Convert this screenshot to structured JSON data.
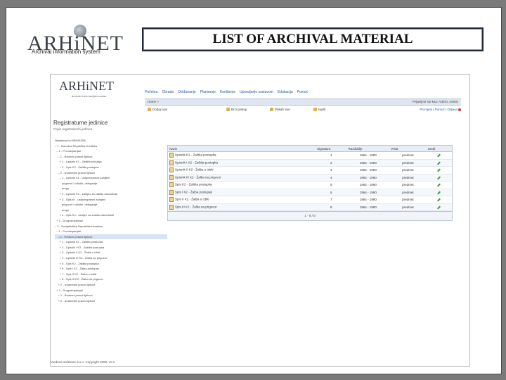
{
  "slide": {
    "logo_text": "ARHiNET",
    "logo_subtitle": "Archival information system",
    "title": "LIST OF ARCHIVAL MATERIAL"
  },
  "app": {
    "logo_text": "ARHiNET",
    "logo_subtitle": "arhivski informacijski sustav",
    "menu": [
      "Početna",
      "Obrada",
      "Održavanje",
      "Planiranje",
      "Korištenje",
      "Upravljanje sustavom",
      "Edukacija",
      "Pomoć"
    ],
    "breadcrumb": "Home »",
    "user_info": "Prijavljeni ste kao: Admin, Admin",
    "toolbar": [
      "Dodaj novi",
      "Brzi pristup",
      "Prikaži sve",
      "Ispiši"
    ],
    "right_tools": "Promjeni | Pomoć | Odjava",
    "panel_title": "Registraturne jedinice",
    "panel_subtitle": "Popis registraturnih jedinica",
    "tree": [
      "Nastavna Kn:NR/NS/SR/...",
      "– 1 - Narodna Republika Hrvatska",
      "  – 1 - Prvostupanjski",
      "    – 1 - Redovni pravni lijekovi",
      "      + 1 - Upisnik K1 - Zaštita položaja",
      "      + 2 - Spis K2 - Zaštita postupka",
      "    – 2 - Izvanredni pravni lijekovi",
      "      – 1 - Upisnik K1 - ustavnopravni zahtjevi",
      "         prigovori i odluke, delegacije",
      "         drugo",
      "      + 2 - Upisnik Kn - zahtjev za zaštitu zakonitosti",
      "      + 3 - Spis Kr - ustavnopravni zahtjevi",
      "         prigovori i odluke, delegacije",
      "         drugo",
      "      + 4 - Spis Kn - zahtjev za zaštitu zakonitosti",
      "  + 2 - Drugostupanjski",
      "– 2 - Socijalistička Republika Hrvatska",
      "  – 1 - Prvostupanjski",
      "    – 1 - Redovni pravni lijekovi",
      "      + 1 - Upisnik K1 - Zaštita postupka",
      "      + 2 - Upisnik I K2 - Zaštita postupka",
      "      + 3 - Upisnik II K2 - Žalba u izbiti",
      "      + 4 - Upisnik III K2 - Žalba na prigovor",
      "      + 5 - Spis K2 - Zaštita postupka",
      "      + 6 - Spis I K2 - Žalba postupak",
      "      + 7 - Spis II K2 - Žalba u izbiti",
      "      + 8 - Spis III K2 - Žalba na prigovor",
      "    + 2 - Izvanredni pravni lijekovi",
      "  + 2 - Drugostupanjski",
      "    + 1 - Redovni pravni lijekovi",
      "    + 2 - Izvanredni pravni lijekovi"
    ],
    "grid_headers": [
      "Naziv",
      "Signatura",
      "Razdoblje",
      "Vrsta",
      "Uredi"
    ],
    "rows": [
      {
        "naziv": "Upisnik K1 - Zaštita postupka",
        "sig": "1",
        "raz": "1964 - 1990",
        "vrsta": "predmet"
      },
      {
        "naziv": "Upisnik I K2 - Zaštita postupka",
        "sig": "2",
        "raz": "1964 - 1990",
        "vrsta": "predmet"
      },
      {
        "naziv": "Upisnik II K2 - Žalba u izbiti",
        "sig": "3",
        "raz": "1964 - 1990",
        "vrsta": "predmet"
      },
      {
        "naziv": "Upisnik III K2 - Žalba na prigovor",
        "sig": "4",
        "raz": "1964 - 1990",
        "vrsta": "predmet"
      },
      {
        "naziv": "Spis K2 - Zaštita postupka",
        "sig": "5",
        "raz": "1964 - 1990",
        "vrsta": "predmet"
      },
      {
        "naziv": "Spis I K2 - Žalba postupak",
        "sig": "6",
        "raz": "1964 - 1990",
        "vrsta": "predmet"
      },
      {
        "naziv": "Spis II K2 - Žalba u izbiti",
        "sig": "7",
        "raz": "1964 - 1990",
        "vrsta": "predmet"
      },
      {
        "naziv": "Spis III K2 - Žalba na prigovor",
        "sig": "8",
        "raz": "1964 - 1990",
        "vrsta": "predmet"
      }
    ],
    "pager": "1 - 8 / 8",
    "footer": "Vordena Software d.o.o. Copyright 2008. v1.0"
  }
}
